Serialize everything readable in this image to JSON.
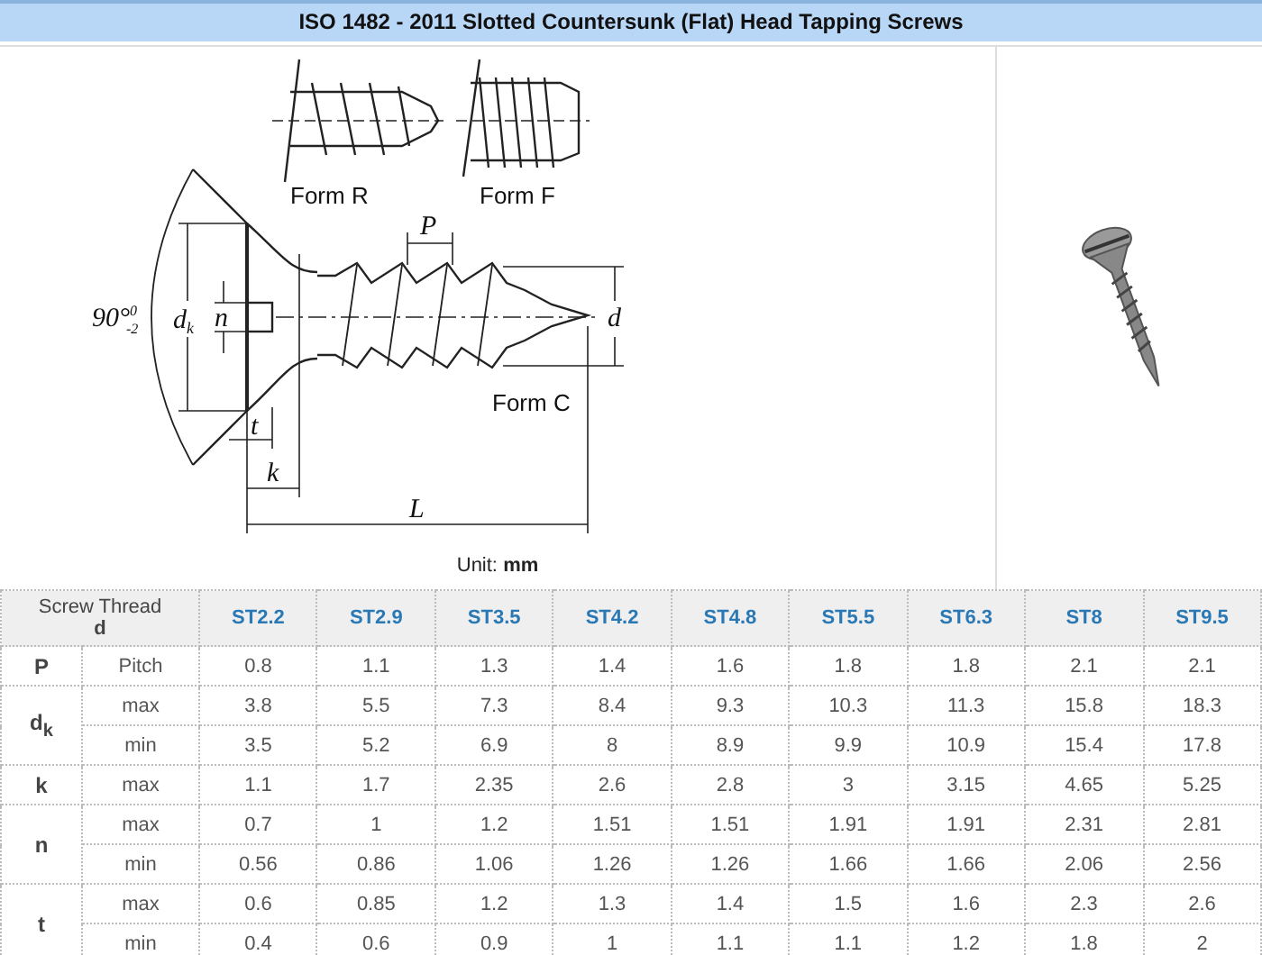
{
  "title": "ISO 1482 - 2011 Slotted Countersunk (Flat) Head Tapping Screws",
  "diagram": {
    "forms": [
      "Form R",
      "Form F",
      "Form C"
    ],
    "angle": "90°",
    "angle_tol_upper": "0",
    "angle_tol_lower": "-2",
    "labels": {
      "dk": "d",
      "dk_sub": "k",
      "n": "n",
      "p": "P",
      "d": "d",
      "t": "t",
      "k": "k",
      "l": "L"
    },
    "unit": "Unit: **mm**"
  },
  "table": {
    "header_label": "Screw Thread",
    "header_symbol": "d",
    "sizes": [
      "ST2.2",
      "ST2.9",
      "ST3.5",
      "ST4.2",
      "ST4.8",
      "ST5.5",
      "ST6.3",
      "ST8",
      "ST9.5"
    ],
    "groups": [
      {
        "symbol": "P",
        "rows": [
          {
            "label": "Pitch",
            "values": [
              "0.8",
              "1.1",
              "1.3",
              "1.4",
              "1.6",
              "1.8",
              "1.8",
              "2.1",
              "2.1"
            ]
          }
        ]
      },
      {
        "symbol": "d$_{k}$",
        "rows": [
          {
            "label": "max",
            "values": [
              "3.8",
              "5.5",
              "7.3",
              "8.4",
              "9.3",
              "10.3",
              "11.3",
              "15.8",
              "18.3"
            ]
          },
          {
            "label": "min",
            "values": [
              "3.5",
              "5.2",
              "6.9",
              "8",
              "8.9",
              "9.9",
              "10.9",
              "15.4",
              "17.8"
            ]
          }
        ]
      },
      {
        "symbol": "k",
        "rows": [
          {
            "label": "max",
            "values": [
              "1.1",
              "1.7",
              "2.35",
              "2.6",
              "2.8",
              "3",
              "3.15",
              "4.65",
              "5.25"
            ]
          }
        ]
      },
      {
        "symbol": "n",
        "rows": [
          {
            "label": "max",
            "values": [
              "0.7",
              "1",
              "1.2",
              "1.51",
              "1.51",
              "1.91",
              "1.91",
              "2.31",
              "2.81"
            ]
          },
          {
            "label": "min",
            "values": [
              "0.56",
              "0.86",
              "1.06",
              "1.26",
              "1.26",
              "1.66",
              "1.66",
              "2.06",
              "2.56"
            ]
          }
        ]
      },
      {
        "symbol": "t",
        "rows": [
          {
            "label": "max",
            "values": [
              "0.6",
              "0.85",
              "1.2",
              "1.3",
              "1.4",
              "1.5",
              "1.6",
              "2.3",
              "2.6"
            ]
          },
          {
            "label": "min",
            "values": [
              "0.4",
              "0.6",
              "0.9",
              "1",
              "1.1",
              "1.1",
              "1.2",
              "1.8",
              "2"
            ]
          }
        ]
      }
    ]
  }
}
